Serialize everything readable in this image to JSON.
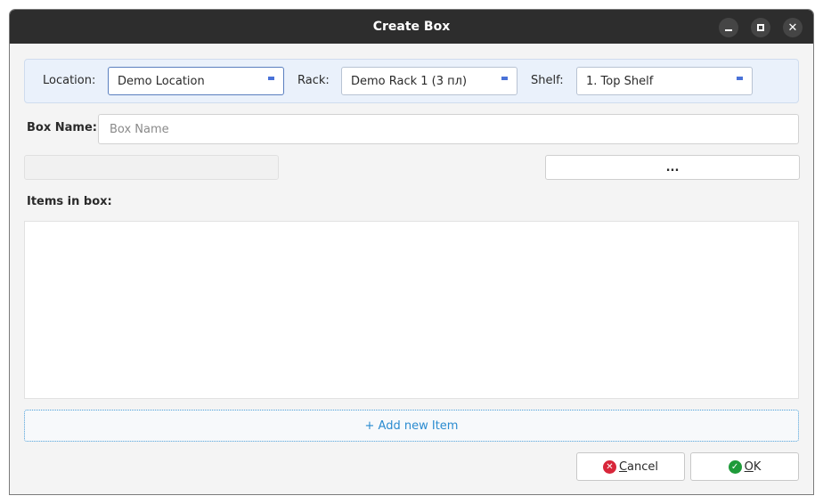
{
  "window": {
    "title": "Create Box",
    "min_icon": "minimize-icon",
    "max_icon": "maximize-icon",
    "close_icon": "close-icon"
  },
  "location_bar": {
    "location_label": "Location:",
    "location_value": "Demo Location",
    "rack_label": "Rack:",
    "rack_value": "Demo Rack 1 (3 пл)",
    "shelf_label": "Shelf:",
    "shelf_value": "1. Top Shelf"
  },
  "box_name": {
    "label": "Box Name:",
    "placeholder": "Box Name"
  },
  "path": {
    "value": "",
    "browse_label": "..."
  },
  "items": {
    "label": "Items in box:",
    "rows": [],
    "add_label": "+ Add new Item"
  },
  "buttons": {
    "cancel": "Cancel",
    "ok": "OK"
  },
  "colors": {
    "titlebar": "#2d2d2d",
    "accent": "#4a72d8",
    "link": "#2a8bd0",
    "cancel_icon": "#d8263a",
    "ok_icon": "#1f9b3a"
  }
}
